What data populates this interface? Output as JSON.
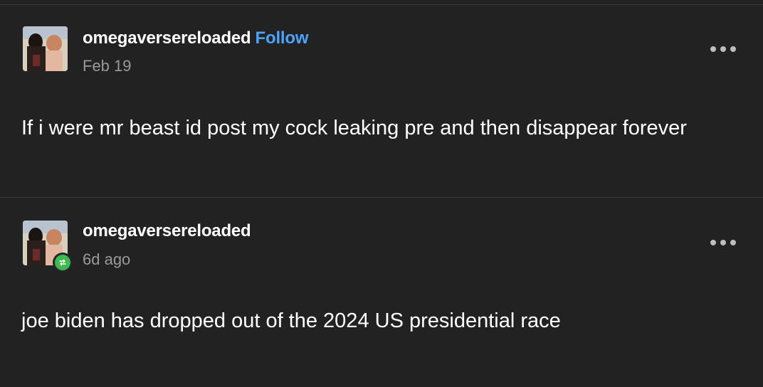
{
  "posts": [
    {
      "username": "omegaversereloaded",
      "follow_label": "Follow",
      "date": "Feb 19",
      "body": "If i were mr beast id post my cock leaking pre and then disappear forever",
      "menu_icon": "more-options-icon"
    },
    {
      "username": "omegaversereloaded",
      "date": "6d ago",
      "body": "joe biden has dropped out of the 2024 US presidential race",
      "menu_icon": "more-options-icon",
      "reblog_icon": "reblog-icon"
    }
  ],
  "colors": {
    "background": "#222222",
    "follow": "#4da3ff",
    "reblog_badge": "#3fb950",
    "muted_text": "#9a9a9a"
  }
}
